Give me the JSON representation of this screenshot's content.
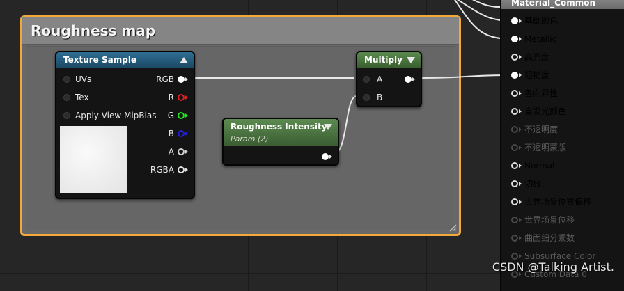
{
  "comment": {
    "title": "Roughness map"
  },
  "texture_sample": {
    "title": "Texture Sample",
    "inputs": [
      "UVs",
      "Tex",
      "Apply View MipBias"
    ],
    "outputs": [
      {
        "label": "RGB",
        "color": "#ffffff"
      },
      {
        "label": "R",
        "color": "#e02020"
      },
      {
        "label": "G",
        "color": "#20e020"
      },
      {
        "label": "B",
        "color": "#2020e0"
      },
      {
        "label": "A",
        "color": "#d0d0d0"
      },
      {
        "label": "RGBA",
        "color": "#ffffff"
      }
    ]
  },
  "multiply": {
    "title": "Multiply",
    "inputs": [
      "A",
      "B"
    ]
  },
  "param": {
    "title": "Roughness Intensity",
    "subtitle": "Param (2)"
  },
  "material": {
    "title": "Material_Common",
    "pins": [
      {
        "label": "基础颜色",
        "connected": true,
        "disabled": false
      },
      {
        "label": "Metallic",
        "connected": true,
        "disabled": false
      },
      {
        "label": "高光度",
        "connected": false,
        "disabled": false
      },
      {
        "label": "粗糙度",
        "connected": true,
        "disabled": false
      },
      {
        "label": "各向异性",
        "connected": false,
        "disabled": false
      },
      {
        "label": "自发光颜色",
        "connected": false,
        "disabled": false
      },
      {
        "label": "不透明度",
        "connected": false,
        "disabled": true
      },
      {
        "label": "不透明蒙版",
        "connected": false,
        "disabled": true
      },
      {
        "label": "Normal",
        "connected": false,
        "disabled": false
      },
      {
        "label": "切线",
        "connected": false,
        "disabled": false
      },
      {
        "label": "世界场景位置偏移",
        "connected": false,
        "disabled": false
      },
      {
        "label": "世界场景位移",
        "connected": false,
        "disabled": true
      },
      {
        "label": "曲面细分乘数",
        "connected": false,
        "disabled": true
      },
      {
        "label": "Subsurface Color",
        "connected": false,
        "disabled": true
      },
      {
        "label": "Custom Data 0",
        "connected": false,
        "disabled": true
      }
    ]
  },
  "watermark": "CSDN @Talking Artist."
}
